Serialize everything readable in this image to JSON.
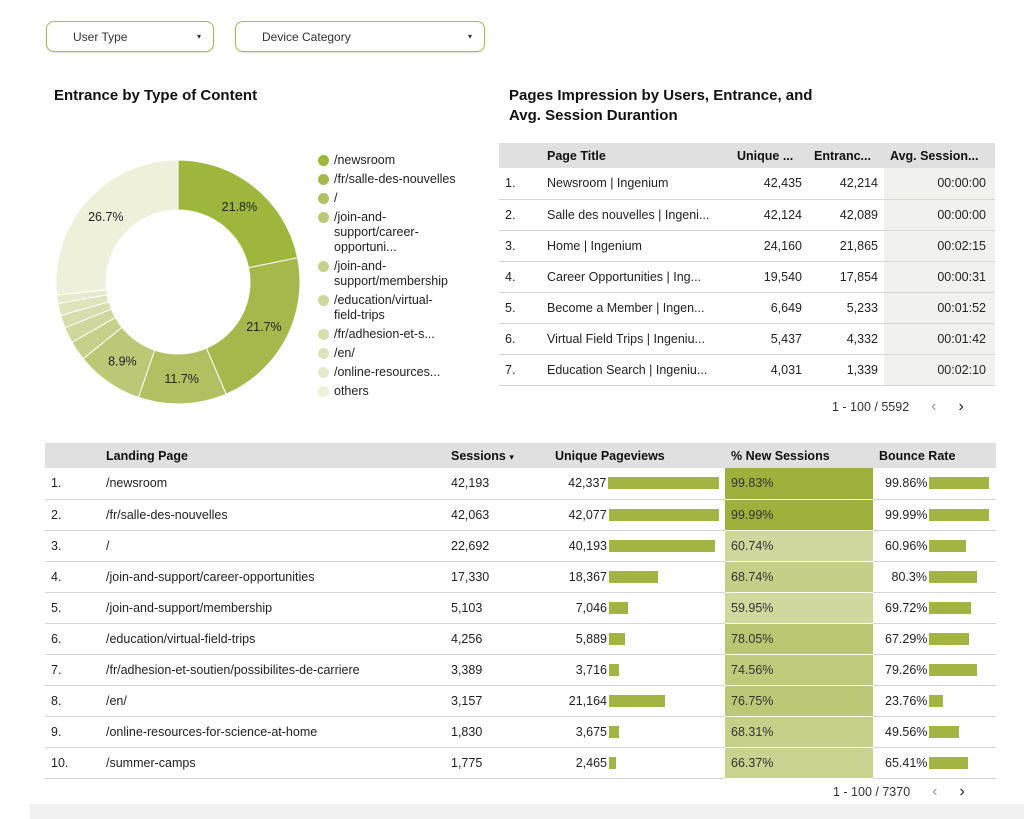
{
  "filters": [
    {
      "label": "User Type"
    },
    {
      "label": "Device Category"
    }
  ],
  "donut": {
    "title": "Entrance by Type of Content",
    "labels_shown": [
      "21.8%",
      "21.7%",
      "11.7%",
      "8.9%",
      "26.7%"
    ],
    "chart_data": {
      "type": "pie",
      "categories": [
        "/newsroom",
        "/fr/salle-des-nouvelles",
        "/",
        "/join-and-support/career-opportuni...",
        "/join-and-support/membership",
        "/education/virtual-field-trips",
        "/fr/adhesion-et-s...",
        "/en/",
        "/online-resources...",
        "others"
      ],
      "values": [
        21.8,
        21.7,
        11.7,
        8.9,
        2.6,
        2.1,
        1.7,
        1.6,
        1.1,
        26.7
      ],
      "colors": [
        "#9db63c",
        "#a6b84c",
        "#b2c061",
        "#bcc876",
        "#c7d08b",
        "#cfd79c",
        "#d7ddac",
        "#dfe3bc",
        "#e6e9cb",
        "#eef0da"
      ]
    }
  },
  "legend": [
    {
      "label": "/newsroom",
      "color": "#9db63c"
    },
    {
      "label": "/fr/salle-des-nouvelles",
      "color": "#a6b84c"
    },
    {
      "label": "/",
      "color": "#b2c061"
    },
    {
      "label": "/join-and-support/career-opportuni...",
      "color": "#bcc876"
    },
    {
      "label": "/join-and-support/membership",
      "color": "#c7d08b"
    },
    {
      "label": "/education/virtual-field-trips",
      "color": "#cfd79c"
    },
    {
      "label": "/fr/adhesion-et-s...",
      "color": "#d7ddac"
    },
    {
      "label": "/en/",
      "color": "#dfe3bc"
    },
    {
      "label": "/online-resources...",
      "color": "#e6e9cb"
    },
    {
      "label": "others",
      "color": "#eef0da"
    }
  ],
  "pages_table": {
    "title": "Pages Impression by Users, Entrance, and Avg. Session Durantion",
    "columns": [
      "Page Title",
      "Unique ...",
      "Entranc...",
      "Avg. Session..."
    ],
    "rows": [
      {
        "n": "1.",
        "title": "Newsroom | Ingenium",
        "unique": "42,435",
        "entr": "42,214",
        "avg": "00:00:00"
      },
      {
        "n": "2.",
        "title": "Salle des nouvelles | Ingeni...",
        "unique": "42,124",
        "entr": "42,089",
        "avg": "00:00:00"
      },
      {
        "n": "3.",
        "title": "Home | Ingenium",
        "unique": "24,160",
        "entr": "21,865",
        "avg": "00:02:15"
      },
      {
        "n": "4.",
        "title": "Career Opportunities | Ing...",
        "unique": "19,540",
        "entr": "17,854",
        "avg": "00:00:31"
      },
      {
        "n": "5.",
        "title": "Become a Member | Ingen...",
        "unique": "6,649",
        "entr": "5,233",
        "avg": "00:01:52"
      },
      {
        "n": "6.",
        "title": "Virtual Field Trips | Ingeniu...",
        "unique": "5,437",
        "entr": "4,332",
        "avg": "00:01:42"
      },
      {
        "n": "7.",
        "title": "Education Search | Ingeniu...",
        "unique": "4,031",
        "entr": "1,339",
        "avg": "00:02:10"
      }
    ],
    "pager": "1 - 100 / 5592"
  },
  "landing_table": {
    "columns": [
      "Landing Page",
      "Sessions",
      "Unique Pageviews",
      "% New Sessions",
      "Bounce Rate"
    ],
    "sort_indicator": "▾",
    "rows": [
      {
        "n": "1.",
        "page": "/newsroom",
        "sessions": "42,193",
        "upv": "42,337",
        "upv_val": 42337,
        "new": "99.83%",
        "new_val": 99.83,
        "bounce": "99.86%",
        "bounce_val": 99.86
      },
      {
        "n": "2.",
        "page": "/fr/salle-des-nouvelles",
        "sessions": "42,063",
        "upv": "42,077",
        "upv_val": 42077,
        "new": "99.99%",
        "new_val": 99.99,
        "bounce": "99.99%",
        "bounce_val": 99.99
      },
      {
        "n": "3.",
        "page": "/",
        "sessions": "22,692",
        "upv": "40,193",
        "upv_val": 40193,
        "new": "60.74%",
        "new_val": 60.74,
        "bounce": "60.96%",
        "bounce_val": 60.96
      },
      {
        "n": "4.",
        "page": "/join-and-support/career-opportunities",
        "sessions": "17,330",
        "upv": "18,367",
        "upv_val": 18367,
        "new": "68.74%",
        "new_val": 68.74,
        "bounce": "80.3%",
        "bounce_val": 80.3
      },
      {
        "n": "5.",
        "page": "/join-and-support/membership",
        "sessions": "5,103",
        "upv": "7,046",
        "upv_val": 7046,
        "new": "59.95%",
        "new_val": 59.95,
        "bounce": "69.72%",
        "bounce_val": 69.72
      },
      {
        "n": "6.",
        "page": "/education/virtual-field-trips",
        "sessions": "4,256",
        "upv": "5,889",
        "upv_val": 5889,
        "new": "78.05%",
        "new_val": 78.05,
        "bounce": "67.29%",
        "bounce_val": 67.29
      },
      {
        "n": "7.",
        "page": "/fr/adhesion-et-soutien/possibilites-de-carriere",
        "sessions": "3,389",
        "upv": "3,716",
        "upv_val": 3716,
        "new": "74.56%",
        "new_val": 74.56,
        "bounce": "79.26%",
        "bounce_val": 79.26
      },
      {
        "n": "8.",
        "page": "/en/",
        "sessions": "3,157",
        "upv": "21,164",
        "upv_val": 21164,
        "new": "76.75%",
        "new_val": 76.75,
        "bounce": "23.76%",
        "bounce_val": 23.76
      },
      {
        "n": "9.",
        "page": "/online-resources-for-science-at-home",
        "sessions": "1,830",
        "upv": "3,675",
        "upv_val": 3675,
        "new": "68.31%",
        "new_val": 68.31,
        "bounce": "49.56%",
        "bounce_val": 49.56
      },
      {
        "n": "10.",
        "page": "/summer-camps",
        "sessions": "1,775",
        "upv": "2,465",
        "upv_val": 2465,
        "new": "66.37%",
        "new_val": 66.37,
        "bounce": "65.41%",
        "bounce_val": 65.41
      }
    ],
    "pager": "1 - 100 / 7370"
  },
  "colors": {
    "accent": "#a3b442",
    "heat_high": "#9fb13c",
    "heat_low": "#d2d9a0"
  },
  "icons": {
    "prev": "‹",
    "next": "›",
    "caret": "▾"
  }
}
